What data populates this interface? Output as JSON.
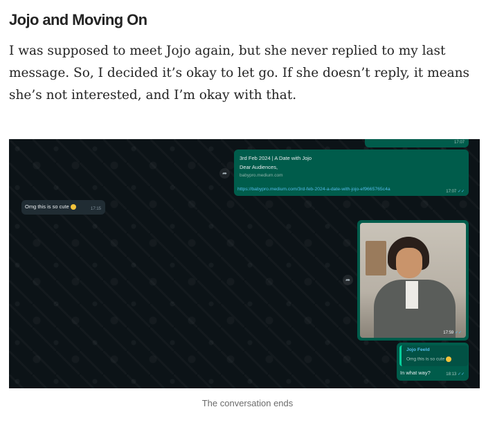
{
  "article": {
    "heading": "Jojo and Moving On",
    "paragraph": "I was supposed to meet Jojo again, but she never replied to my last message. So, I decided it’s okay to let go. If she doesn’t reply, it means she’s not interested, and I’m okay with that."
  },
  "chat": {
    "top_stub_time": "17:07",
    "link_card": {
      "title": "3rd Feb 2024 | A Date with Jojo",
      "description": "Dear Audiences,",
      "host": "babypro.medium.com",
      "url": "https://babypro.medium.com/3rd-feb-2024-a-date-with-jojo-ef9665765c4a",
      "time": "17:07"
    },
    "incoming": {
      "text": "Omg this is so cute",
      "emoji_icon": "smiling-face-with-hearts-icon",
      "time": "17:15"
    },
    "photo": {
      "time": "17:59"
    },
    "reply": {
      "quoted_name": "Jojo Feeld",
      "quoted_text": "Omg this is so cute",
      "text": "In what way?",
      "time": "18:13"
    },
    "colors": {
      "background": "#0c1317",
      "outgoing_bubble": "#005c4b",
      "incoming_bubble": "#202c33",
      "link": "#53bdeb",
      "read_tick": "#53bdeb"
    }
  },
  "caption": "The conversation ends"
}
